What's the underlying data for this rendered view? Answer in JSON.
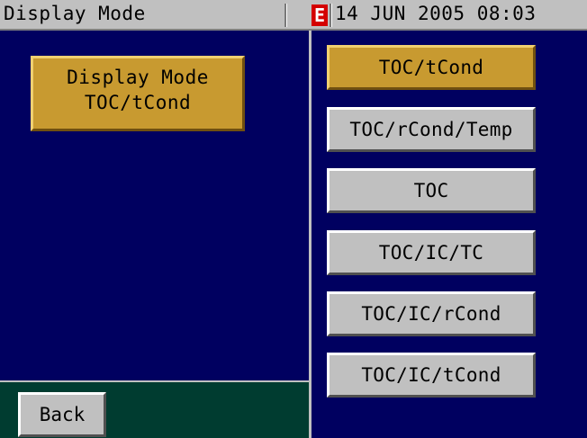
{
  "header": {
    "title": "Display Mode",
    "error_indicator": "E",
    "datetime": "14 JUN 2005 08:03"
  },
  "info_box": {
    "line1": "Display Mode",
    "line2": "TOC/tCond"
  },
  "mode_options": [
    {
      "label": "TOC/tCond",
      "selected": true
    },
    {
      "label": "TOC/rCond/Temp",
      "selected": false
    },
    {
      "label": "TOC",
      "selected": false
    },
    {
      "label": "TOC/IC/TC",
      "selected": false
    },
    {
      "label": "TOC/IC/rCond",
      "selected": false
    },
    {
      "label": "TOC/IC/tCond",
      "selected": false
    }
  ],
  "footer": {
    "back_label": "Back"
  },
  "colors": {
    "background_panel": "#000060",
    "selected_highlight": "#c89a30",
    "button_gray": "#c0c0c0",
    "footer_bg": "#003c30",
    "error_red": "#d40000"
  }
}
